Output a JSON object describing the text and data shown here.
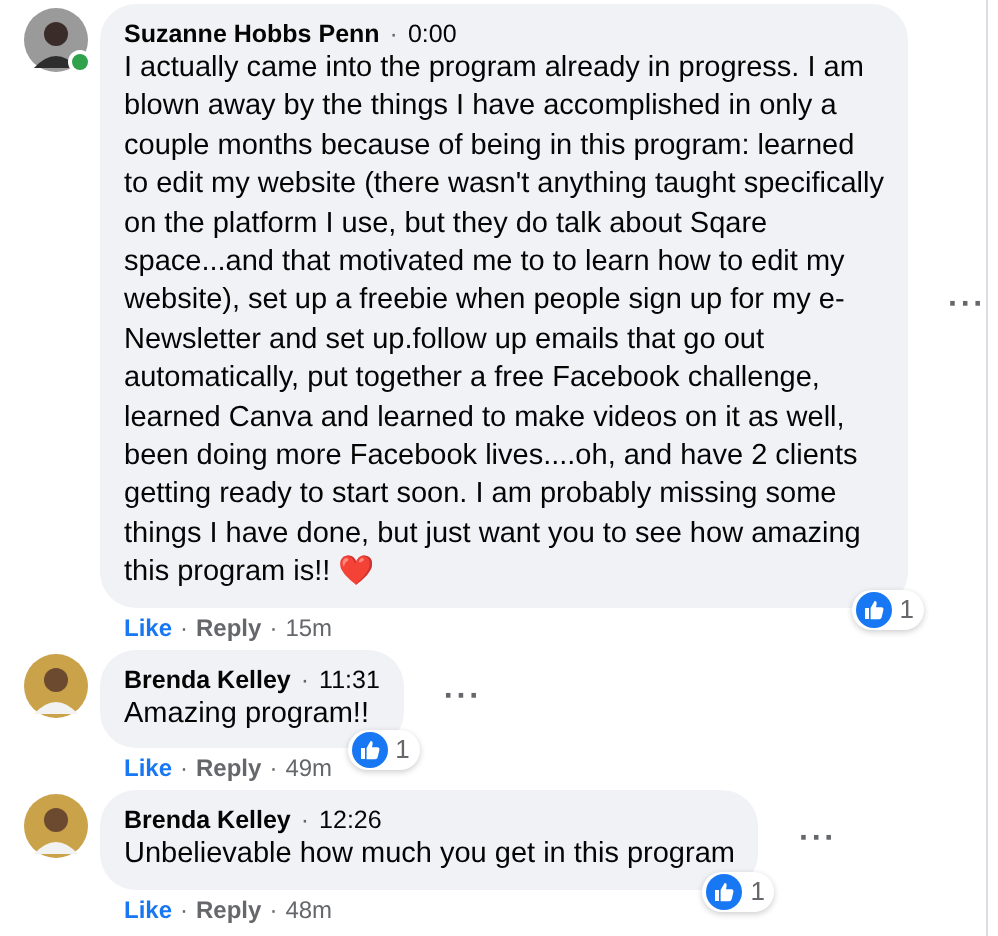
{
  "comments": [
    {
      "author": "Suzanne Hobbs Penn",
      "head_sep": "·",
      "time": "0:00",
      "online": true,
      "body": "I actually came into the program already in progress. I am blown away by the things I have accomplished in only a couple months because of being in this program: learned to edit my website (there wasn't anything taught specifically on the platform I use, but they do talk about Sqare space...and that motivated me to to learn how to edit my website), set up a freebie when people sign up for my e-Newsletter and set up.follow up emails that go out automatically, put together a free Facebook challenge, learned Canva and learned to make videos on it as well, been doing more Facebook lives....oh, and have 2 clients getting ready to start soon. I am probably missing some things I have done, but just want you to see how amazing this program is!! ❤️",
      "like": "Like",
      "action_seps": [
        "·",
        "·"
      ],
      "reply": "Reply",
      "age": "15m",
      "reactions": "1",
      "more": "···"
    },
    {
      "author": "Brenda Kelley",
      "head_sep": "·",
      "time": "11:31",
      "online": false,
      "body": "Amazing program!!",
      "like": "Like",
      "action_seps": [
        "·",
        "·"
      ],
      "reply": "Reply",
      "age": "49m",
      "reactions": "1",
      "more": "···"
    },
    {
      "author": "Brenda Kelley",
      "head_sep": "·",
      "time": "12:26",
      "online": false,
      "body": "Unbelievable how much you get in this program",
      "like": "Like",
      "action_seps": [
        "·",
        "·"
      ],
      "reply": "Reply",
      "age": "48m",
      "reactions": "1",
      "more": "···"
    }
  ]
}
